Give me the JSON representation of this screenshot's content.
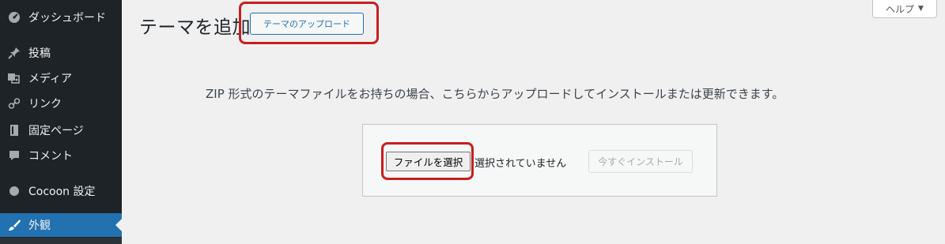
{
  "sidebar": {
    "items": [
      {
        "label": "ダッシュボード",
        "icon": "dashboard-icon",
        "active": false
      },
      {
        "label": "投稿",
        "icon": "pin-icon",
        "active": false
      },
      {
        "label": "メディア",
        "icon": "media-icon",
        "active": false
      },
      {
        "label": "リンク",
        "icon": "link-icon",
        "active": false
      },
      {
        "label": "固定ページ",
        "icon": "page-icon",
        "active": false
      },
      {
        "label": "コメント",
        "icon": "comment-icon",
        "active": false
      },
      {
        "label": "Cocoon 設定",
        "icon": "circle-icon",
        "active": false
      },
      {
        "label": "外観",
        "icon": "brush-icon",
        "active": true
      }
    ]
  },
  "header": {
    "title": "テーマを追加",
    "upload_button": "テーマのアップロード",
    "help_label": "ヘルプ",
    "help_caret": "▼"
  },
  "main": {
    "description": "ZIP 形式のテーマファイルをお持ちの場合、こちらからアップロードしてインストールまたは更新できます。",
    "file_button": "ファイルを選択",
    "no_file_text": "選択されていません",
    "install_button": "今すぐインストール"
  },
  "colors": {
    "sidebar_bg": "#1d2327",
    "active_bg": "#2271b1",
    "highlight": "#c81e1e",
    "page_bg": "#f0f0f1"
  }
}
